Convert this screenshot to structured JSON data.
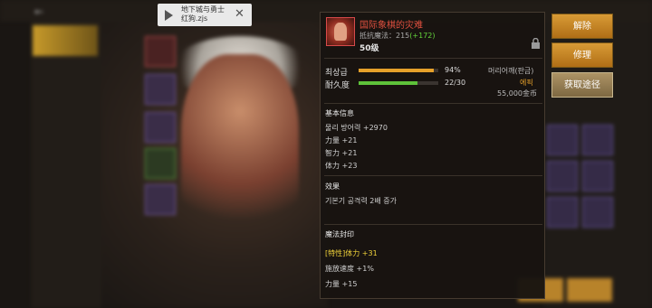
{
  "video_popup": {
    "filename": "地下城与勇士红狗.zjs"
  },
  "item": {
    "name": "国际象棋的灾难",
    "magic_resist": "抵抗魔法：215",
    "magic_bonus": "(+172)",
    "level": "50级",
    "grade_label": "최상급",
    "grade_percent": 94,
    "grade_value": "94%",
    "durability_label": "耐久度",
    "durability_current": 22,
    "durability_max": 30,
    "durability_value": "22/30",
    "owner": "머리어깨(판금)",
    "rarity": "에픽",
    "price": "55,000金币"
  },
  "basic": {
    "title": "基本信息",
    "lines": [
      "물리 방어력 +2970",
      "力量 +21",
      "智力 +21",
      "体力 +23"
    ]
  },
  "effect": {
    "title": "效果",
    "lines": [
      "기본기 공격력 2배 증가"
    ]
  },
  "seal": {
    "title": "魔法封印",
    "lines": [
      "[特性]体力 +31",
      "施放速度 +1%",
      "力量 +15"
    ]
  },
  "buttons": {
    "dismantle": "解除",
    "repair": "修理",
    "source": "获取途径"
  },
  "colors": {
    "item_name": "#e0503f",
    "bonus": "#64d43c",
    "grade_bar": "#e6a12a",
    "durability_bar": "#5ec23a",
    "epic": "#e6a12a"
  }
}
